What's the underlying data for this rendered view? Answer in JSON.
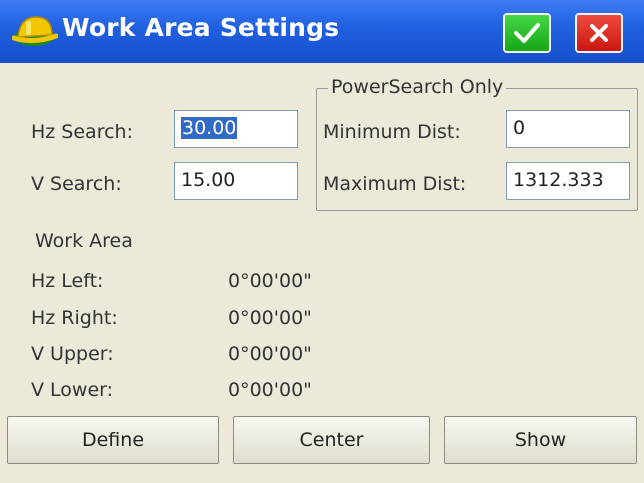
{
  "window": {
    "title": "Work Area Settings",
    "icons": {
      "app": "hardhat-icon",
      "ok": "checkmark-icon",
      "close": "close-x-icon"
    },
    "colors": {
      "titlebar": "#1f5fe0",
      "ok": "#22b322",
      "close": "#dd2417",
      "background": "#ece9d8"
    }
  },
  "search": {
    "hz_label": "Hz Search:",
    "hz_value": "30.00",
    "v_label": "V Search:",
    "v_value": "15.00"
  },
  "powersearch": {
    "title": "PowerSearch Only",
    "min_label": "Minimum Dist:",
    "min_value": "0",
    "max_label": "Maximum Dist:",
    "max_value": "1312.333"
  },
  "work_area": {
    "heading": "Work Area",
    "rows": [
      {
        "label": "Hz Left:",
        "value": "0°00'00\""
      },
      {
        "label": "Hz Right:",
        "value": "0°00'00\""
      },
      {
        "label": "V Upper:",
        "value": "0°00'00\""
      },
      {
        "label": "V Lower:",
        "value": "0°00'00\""
      }
    ]
  },
  "buttons": {
    "define": "Define",
    "center": "Center",
    "show": "Show"
  }
}
